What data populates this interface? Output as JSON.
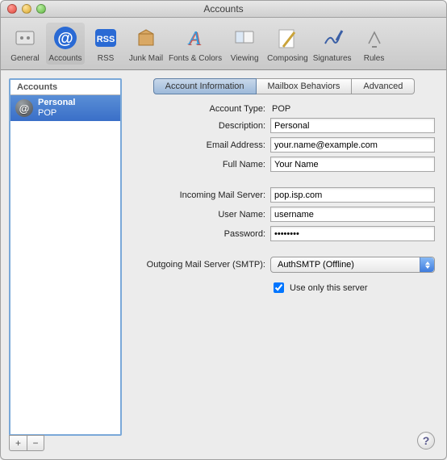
{
  "window": {
    "title": "Accounts"
  },
  "toolbar": {
    "items": [
      {
        "label": "General"
      },
      {
        "label": "Accounts"
      },
      {
        "label": "RSS"
      },
      {
        "label": "Junk Mail"
      },
      {
        "label": "Fonts & Colors"
      },
      {
        "label": "Viewing"
      },
      {
        "label": "Composing"
      },
      {
        "label": "Signatures"
      },
      {
        "label": "Rules"
      }
    ]
  },
  "sidebar": {
    "header": "Accounts",
    "item": {
      "name": "Personal",
      "type": "POP"
    }
  },
  "tabs": {
    "t0": "Account Information",
    "t1": "Mailbox Behaviors",
    "t2": "Advanced"
  },
  "form": {
    "account_type_label": "Account Type:",
    "account_type_value": "POP",
    "description_label": "Description:",
    "description_value": "Personal",
    "email_label": "Email Address:",
    "email_value": "your.name@example.com",
    "fullname_label": "Full Name:",
    "fullname_value": "Your Name",
    "incoming_label": "Incoming Mail Server:",
    "incoming_value": "pop.isp.com",
    "username_label": "User Name:",
    "username_value": "username",
    "password_label": "Password:",
    "password_value": "••••••••",
    "outgoing_label": "Outgoing Mail Server (SMTP):",
    "outgoing_value": "AuthSMTP (Offline)",
    "use_only_label": "Use only this server"
  },
  "buttons": {
    "add": "+",
    "remove": "−",
    "help": "?"
  }
}
